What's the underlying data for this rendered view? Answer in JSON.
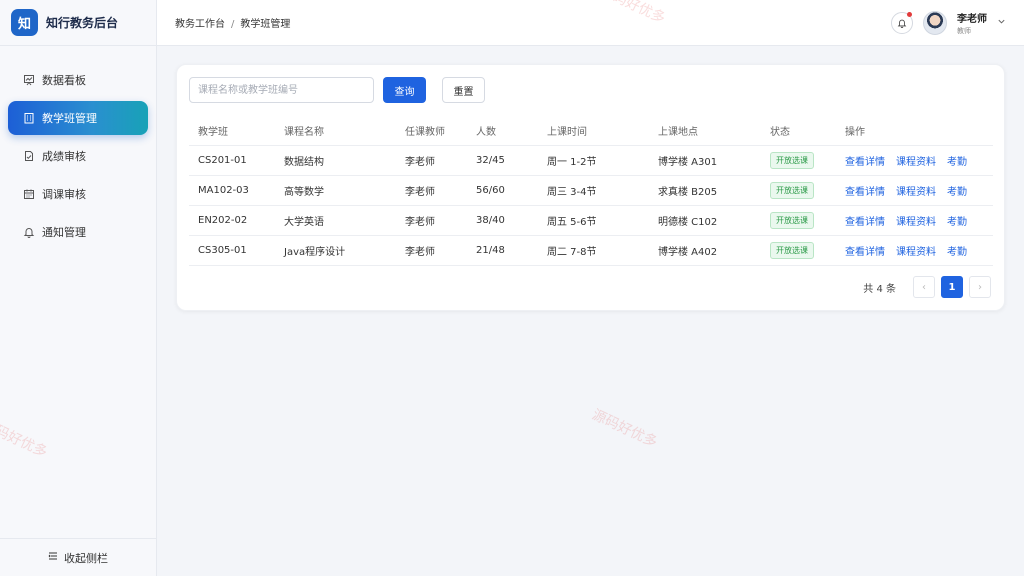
{
  "brand": {
    "logo": "知",
    "title": "知行教务后台"
  },
  "sidebar": {
    "items": [
      {
        "label": "数据看板",
        "icon": "chart-board-icon"
      },
      {
        "label": "教学班管理",
        "icon": "building-icon",
        "active": true
      },
      {
        "label": "成绩审核",
        "icon": "document-check-icon"
      },
      {
        "label": "调课审核",
        "icon": "calendar-icon"
      },
      {
        "label": "通知管理",
        "icon": "bell-icon"
      }
    ],
    "collapse_label": "收起侧栏"
  },
  "header": {
    "breadcrumb": [
      "教务工作台",
      "教学班管理"
    ],
    "user_name": "李老师",
    "user_role": "教师"
  },
  "search": {
    "placeholder": "课程名称或教学班编号",
    "value": "",
    "query_label": "查询",
    "reset_label": "重置"
  },
  "table": {
    "columns": [
      "教学班",
      "课程名称",
      "任课教师",
      "人数",
      "上课时间",
      "上课地点",
      "状态",
      "操作"
    ],
    "rows": [
      {
        "id": "CS201-01",
        "course": "数据结构",
        "teacher": "李老师",
        "count": "32/45",
        "time": "周一 1-2节",
        "place": "博学楼 A301",
        "status": "开放选课"
      },
      {
        "id": "MA102-03",
        "course": "高等数学",
        "teacher": "李老师",
        "count": "56/60",
        "time": "周三 3-4节",
        "place": "求真楼 B205",
        "status": "开放选课"
      },
      {
        "id": "EN202-02",
        "course": "大学英语",
        "teacher": "李老师",
        "count": "38/40",
        "time": "周五 5-6节",
        "place": "明德楼 C102",
        "status": "开放选课"
      },
      {
        "id": "CS305-01",
        "course": "Java程序设计",
        "teacher": "李老师",
        "count": "21/48",
        "time": "周二 7-8节",
        "place": "博学楼 A402",
        "status": "开放选课"
      }
    ],
    "actions": [
      "查看详情",
      "课程资料",
      "考勤"
    ]
  },
  "pagination": {
    "total_label": "共 4 条",
    "prev": "‹",
    "current": "1",
    "next": "›"
  },
  "watermark": "源码好优多",
  "colors": {
    "primary": "#1f63e0",
    "status_green": "#2e9b4a",
    "notify_dot": "#e23b3b"
  }
}
